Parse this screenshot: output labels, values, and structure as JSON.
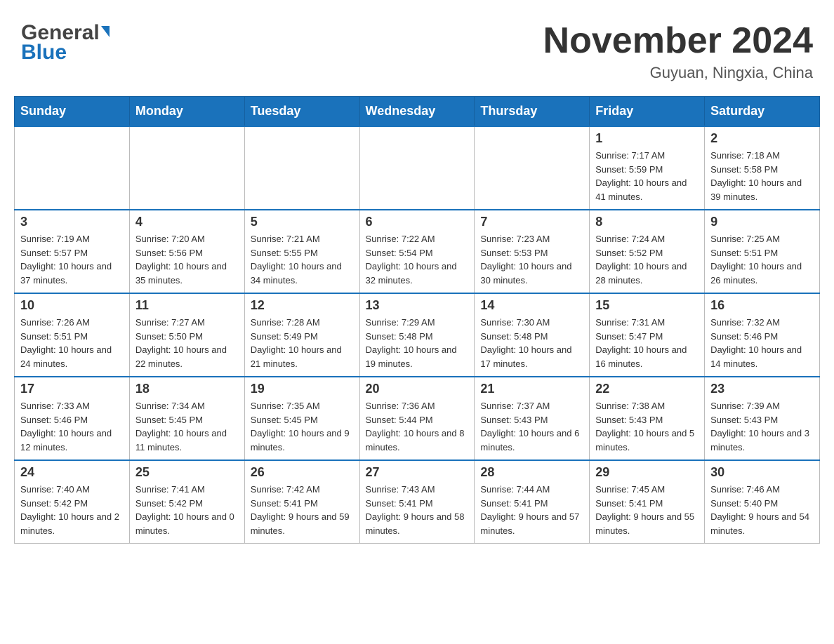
{
  "header": {
    "logo_general": "General",
    "logo_blue": "Blue",
    "month_title": "November 2024",
    "location": "Guyuan, Ningxia, China"
  },
  "days_of_week": [
    "Sunday",
    "Monday",
    "Tuesday",
    "Wednesday",
    "Thursday",
    "Friday",
    "Saturday"
  ],
  "weeks": [
    [
      {
        "day": "",
        "info": ""
      },
      {
        "day": "",
        "info": ""
      },
      {
        "day": "",
        "info": ""
      },
      {
        "day": "",
        "info": ""
      },
      {
        "day": "",
        "info": ""
      },
      {
        "day": "1",
        "info": "Sunrise: 7:17 AM\nSunset: 5:59 PM\nDaylight: 10 hours and 41 minutes."
      },
      {
        "day": "2",
        "info": "Sunrise: 7:18 AM\nSunset: 5:58 PM\nDaylight: 10 hours and 39 minutes."
      }
    ],
    [
      {
        "day": "3",
        "info": "Sunrise: 7:19 AM\nSunset: 5:57 PM\nDaylight: 10 hours and 37 minutes."
      },
      {
        "day": "4",
        "info": "Sunrise: 7:20 AM\nSunset: 5:56 PM\nDaylight: 10 hours and 35 minutes."
      },
      {
        "day": "5",
        "info": "Sunrise: 7:21 AM\nSunset: 5:55 PM\nDaylight: 10 hours and 34 minutes."
      },
      {
        "day": "6",
        "info": "Sunrise: 7:22 AM\nSunset: 5:54 PM\nDaylight: 10 hours and 32 minutes."
      },
      {
        "day": "7",
        "info": "Sunrise: 7:23 AM\nSunset: 5:53 PM\nDaylight: 10 hours and 30 minutes."
      },
      {
        "day": "8",
        "info": "Sunrise: 7:24 AM\nSunset: 5:52 PM\nDaylight: 10 hours and 28 minutes."
      },
      {
        "day": "9",
        "info": "Sunrise: 7:25 AM\nSunset: 5:51 PM\nDaylight: 10 hours and 26 minutes."
      }
    ],
    [
      {
        "day": "10",
        "info": "Sunrise: 7:26 AM\nSunset: 5:51 PM\nDaylight: 10 hours and 24 minutes."
      },
      {
        "day": "11",
        "info": "Sunrise: 7:27 AM\nSunset: 5:50 PM\nDaylight: 10 hours and 22 minutes."
      },
      {
        "day": "12",
        "info": "Sunrise: 7:28 AM\nSunset: 5:49 PM\nDaylight: 10 hours and 21 minutes."
      },
      {
        "day": "13",
        "info": "Sunrise: 7:29 AM\nSunset: 5:48 PM\nDaylight: 10 hours and 19 minutes."
      },
      {
        "day": "14",
        "info": "Sunrise: 7:30 AM\nSunset: 5:48 PM\nDaylight: 10 hours and 17 minutes."
      },
      {
        "day": "15",
        "info": "Sunrise: 7:31 AM\nSunset: 5:47 PM\nDaylight: 10 hours and 16 minutes."
      },
      {
        "day": "16",
        "info": "Sunrise: 7:32 AM\nSunset: 5:46 PM\nDaylight: 10 hours and 14 minutes."
      }
    ],
    [
      {
        "day": "17",
        "info": "Sunrise: 7:33 AM\nSunset: 5:46 PM\nDaylight: 10 hours and 12 minutes."
      },
      {
        "day": "18",
        "info": "Sunrise: 7:34 AM\nSunset: 5:45 PM\nDaylight: 10 hours and 11 minutes."
      },
      {
        "day": "19",
        "info": "Sunrise: 7:35 AM\nSunset: 5:45 PM\nDaylight: 10 hours and 9 minutes."
      },
      {
        "day": "20",
        "info": "Sunrise: 7:36 AM\nSunset: 5:44 PM\nDaylight: 10 hours and 8 minutes."
      },
      {
        "day": "21",
        "info": "Sunrise: 7:37 AM\nSunset: 5:43 PM\nDaylight: 10 hours and 6 minutes."
      },
      {
        "day": "22",
        "info": "Sunrise: 7:38 AM\nSunset: 5:43 PM\nDaylight: 10 hours and 5 minutes."
      },
      {
        "day": "23",
        "info": "Sunrise: 7:39 AM\nSunset: 5:43 PM\nDaylight: 10 hours and 3 minutes."
      }
    ],
    [
      {
        "day": "24",
        "info": "Sunrise: 7:40 AM\nSunset: 5:42 PM\nDaylight: 10 hours and 2 minutes."
      },
      {
        "day": "25",
        "info": "Sunrise: 7:41 AM\nSunset: 5:42 PM\nDaylight: 10 hours and 0 minutes."
      },
      {
        "day": "26",
        "info": "Sunrise: 7:42 AM\nSunset: 5:41 PM\nDaylight: 9 hours and 59 minutes."
      },
      {
        "day": "27",
        "info": "Sunrise: 7:43 AM\nSunset: 5:41 PM\nDaylight: 9 hours and 58 minutes."
      },
      {
        "day": "28",
        "info": "Sunrise: 7:44 AM\nSunset: 5:41 PM\nDaylight: 9 hours and 57 minutes."
      },
      {
        "day": "29",
        "info": "Sunrise: 7:45 AM\nSunset: 5:41 PM\nDaylight: 9 hours and 55 minutes."
      },
      {
        "day": "30",
        "info": "Sunrise: 7:46 AM\nSunset: 5:40 PM\nDaylight: 9 hours and 54 minutes."
      }
    ]
  ]
}
